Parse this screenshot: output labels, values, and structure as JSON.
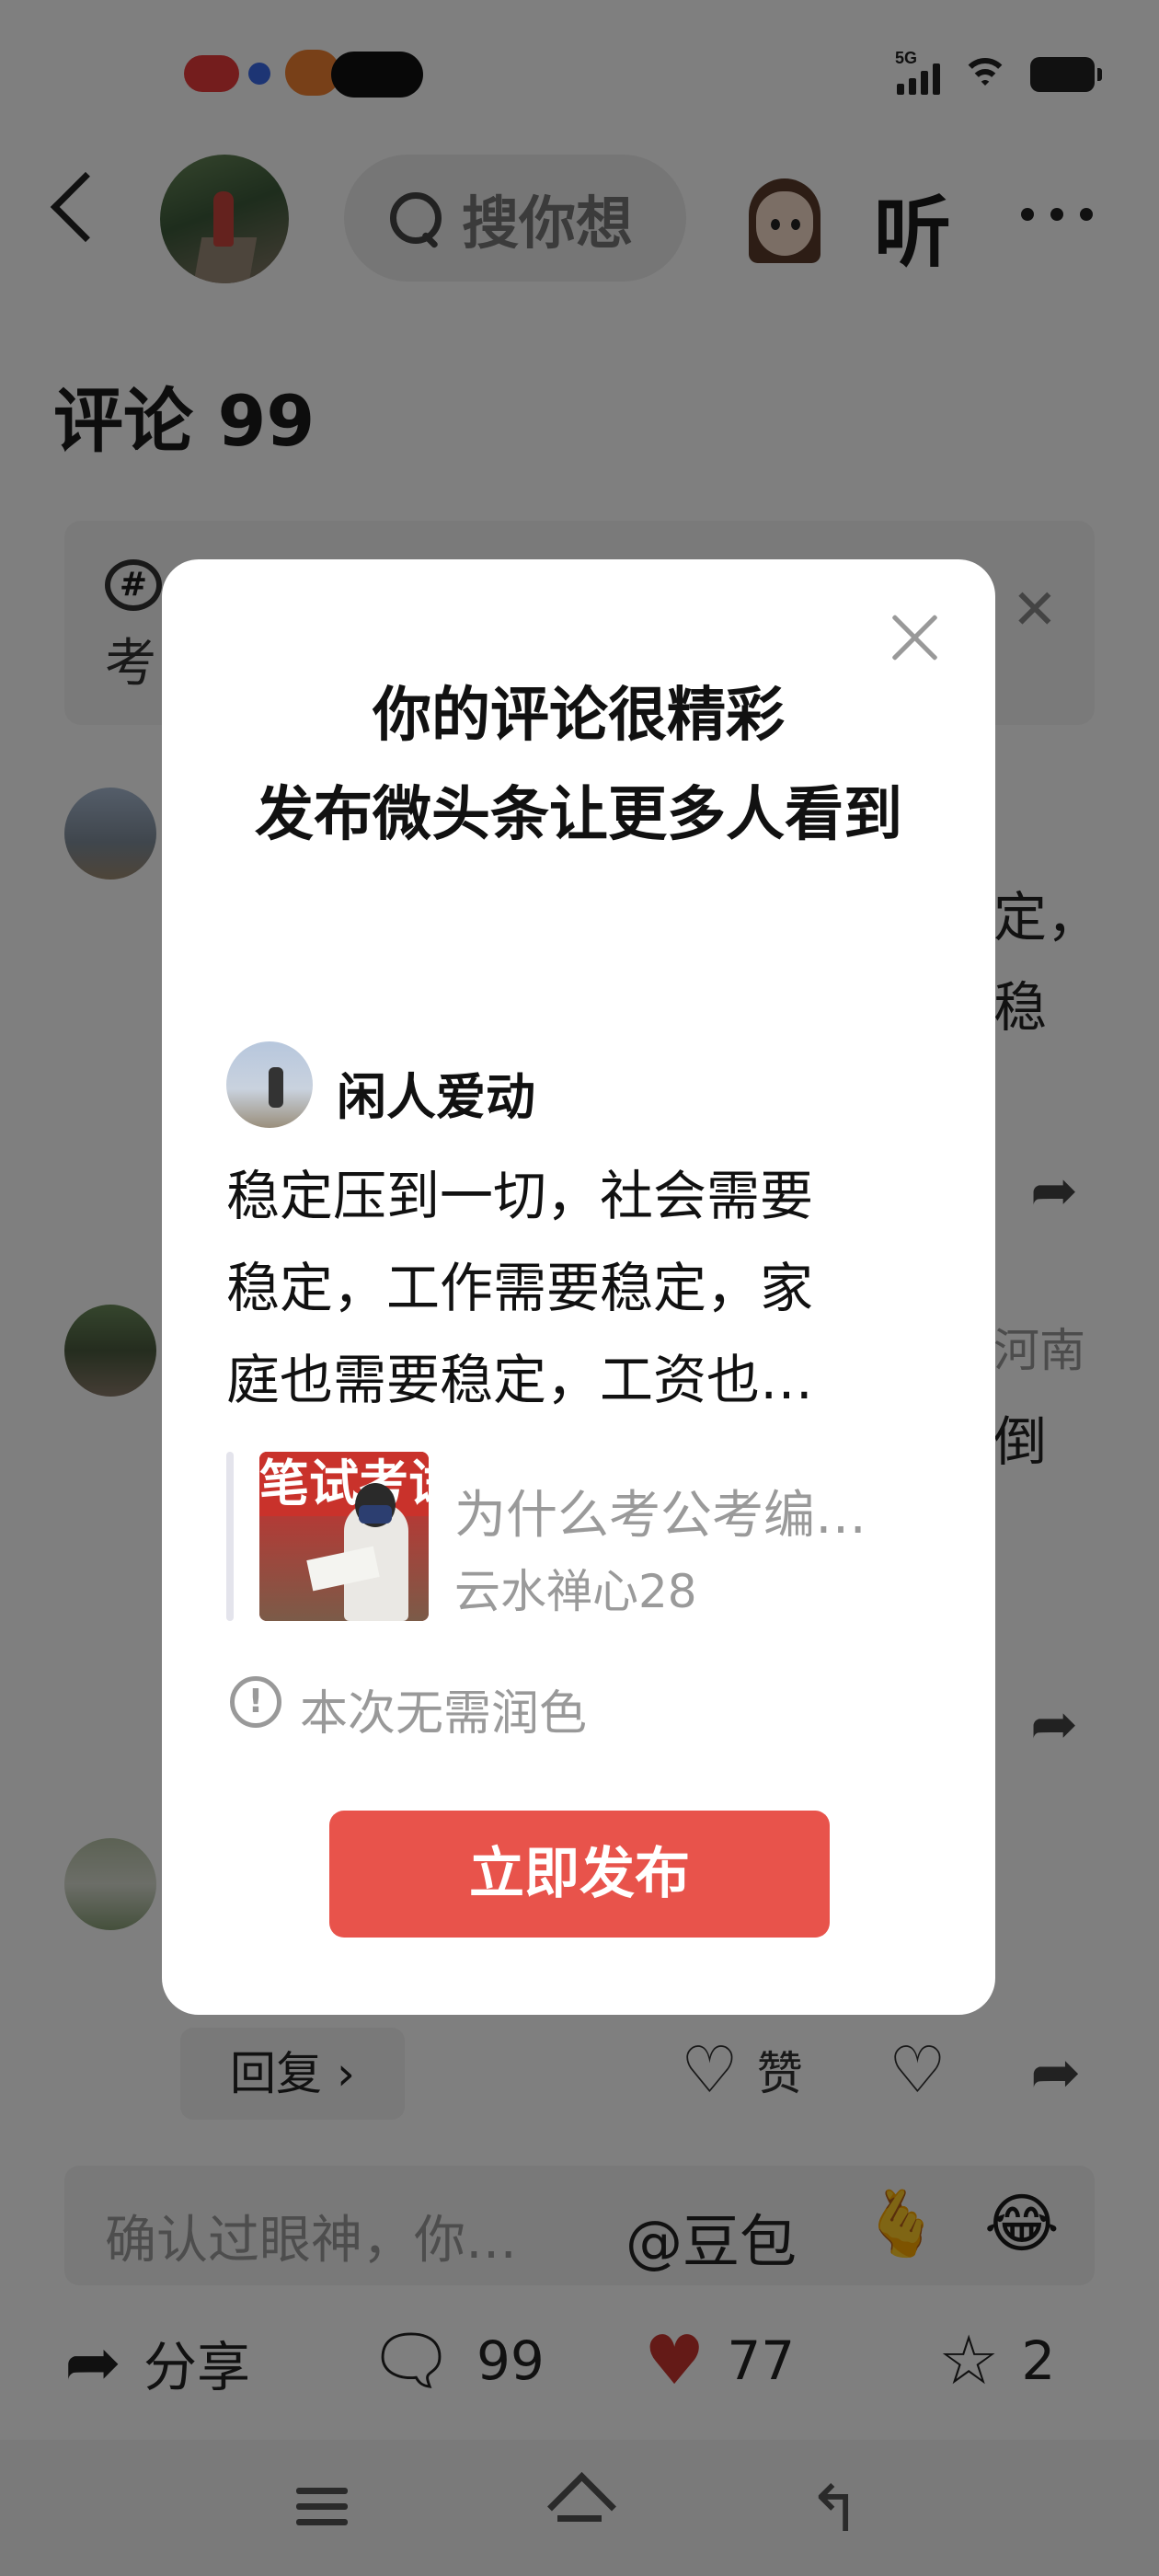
{
  "status_bar": {
    "network": "5G"
  },
  "top_bar": {
    "search_placeholder": "搜你想",
    "listen_label": "听"
  },
  "comments": {
    "title": "评论 99",
    "topic_text": "考",
    "item1_fragment_a": "定，",
    "item1_fragment_b": "稳",
    "item2_location": "河南",
    "item2_fragment": "倒",
    "reply_label": "回复 ›",
    "like_label": "赞"
  },
  "input_bar": {
    "placeholder": "确认过眼神，你…",
    "doubao": "@豆包"
  },
  "action_bar": {
    "share_label": "分享",
    "comment_count": "99",
    "like_count": "77",
    "favorite_count": "2"
  },
  "modal": {
    "title_line1": "你的评论很精彩",
    "title_line2": "发布微头条让更多人看到",
    "author": "闲人爱动",
    "body_lines": [
      "稳定压到一切，社会需要",
      "稳定，工作需要稳定，家",
      "庭也需要稳定，工资也…"
    ],
    "article_thumb_text": "笔试考试",
    "article_title": "为什么考公考编…",
    "article_author": "云水禅心28",
    "notice": "本次无需润色",
    "publish_label": "立即发布"
  },
  "colors": {
    "publish_button": "#e8534b",
    "heart_red": "#c8352e",
    "scrim": "rgba(0,0,0,0.5)"
  }
}
